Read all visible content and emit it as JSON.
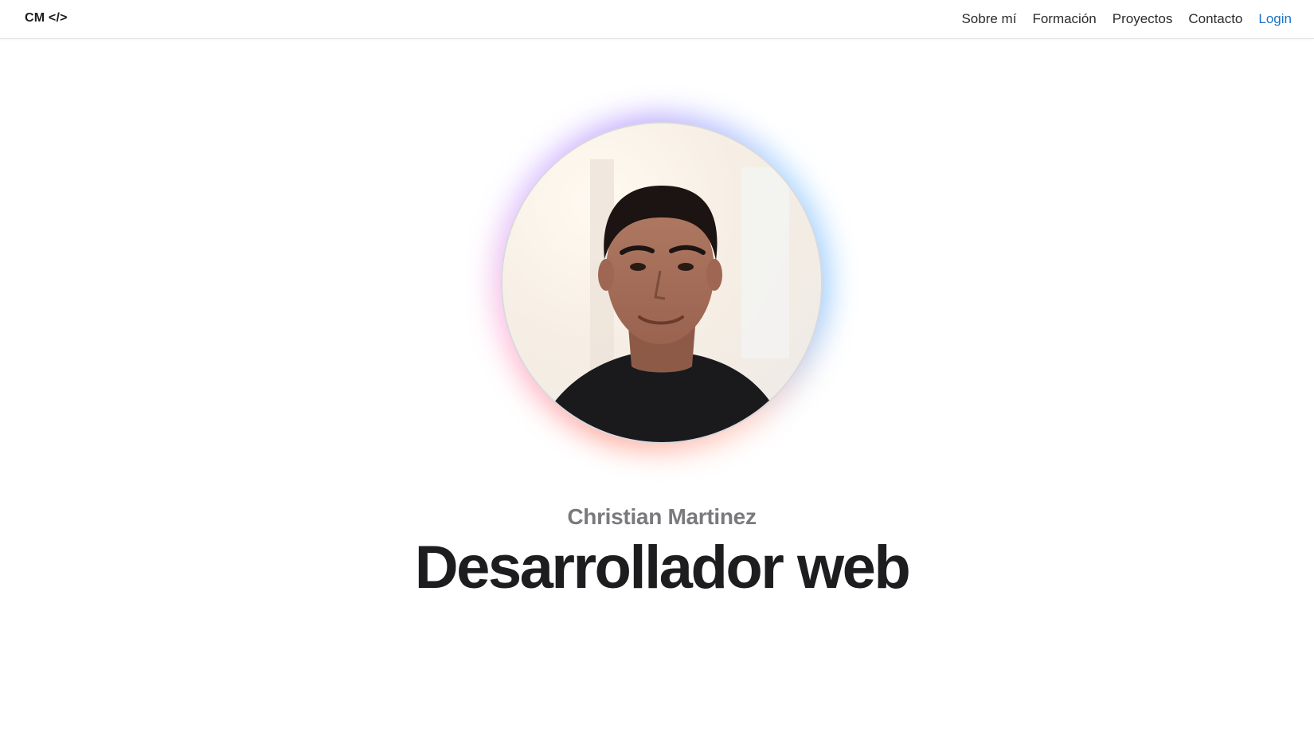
{
  "navbar": {
    "brand": "CM </>",
    "links": [
      {
        "label": "Sobre mí"
      },
      {
        "label": "Formación"
      },
      {
        "label": "Proyectos"
      },
      {
        "label": "Contacto"
      },
      {
        "label": "Login"
      }
    ]
  },
  "hero": {
    "name": "Christian Martinez",
    "title": "Desarrollador web",
    "avatar_icon": "profile-photo"
  },
  "colors": {
    "accent_link": "#1a73c8",
    "text_primary": "#1d1d1f",
    "text_secondary": "#7a7a7e"
  }
}
